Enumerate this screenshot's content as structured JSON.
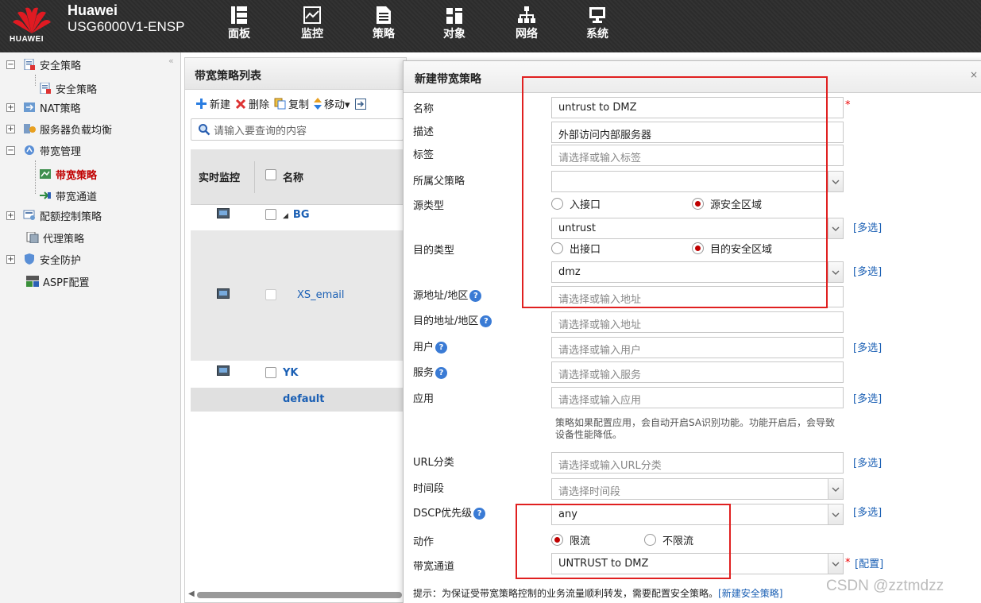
{
  "header": {
    "brand_line1": "Huawei",
    "brand_line2": "USG6000V1-ENSP",
    "logo_text": "HUAWEI",
    "nav": [
      {
        "label": "面板",
        "icon": "dashboard-icon"
      },
      {
        "label": "监控",
        "icon": "monitor-icon"
      },
      {
        "label": "策略",
        "icon": "policy-icon"
      },
      {
        "label": "对象",
        "icon": "object-icon"
      },
      {
        "label": "网络",
        "icon": "network-icon"
      },
      {
        "label": "系统",
        "icon": "system-icon"
      }
    ]
  },
  "sidebar": {
    "collapse": "«",
    "items": [
      {
        "label": "安全策略",
        "expander": "−"
      },
      {
        "label": "安全策略"
      },
      {
        "label": "NAT策略",
        "expander": "+"
      },
      {
        "label": "服务器负载均衡",
        "expander": "+"
      },
      {
        "label": "带宽管理",
        "expander": "−"
      },
      {
        "label": "带宽策略",
        "active": true
      },
      {
        "label": "带宽通道"
      },
      {
        "label": "配额控制策略",
        "expander": "+"
      },
      {
        "label": "代理策略"
      },
      {
        "label": "安全防护",
        "expander": "+"
      },
      {
        "label": "ASPF配置"
      }
    ]
  },
  "list": {
    "title": "带宽策略列表",
    "toolbar": {
      "new": "新建",
      "delete": "删除",
      "copy": "复制",
      "move": "移动▾"
    },
    "search_placeholder": "请输入要查询的内容",
    "columns": {
      "monitor": "实时监控",
      "name": "名称"
    },
    "rows": [
      {
        "name": "BG",
        "prefix": "◢"
      },
      {
        "name": "XS_email"
      },
      {
        "name": "YK"
      },
      {
        "name": "default"
      }
    ]
  },
  "dialog": {
    "title": "新建带宽策略",
    "close": "×",
    "fields": {
      "name": {
        "label": "名称",
        "value": "untrust to DMZ"
      },
      "desc": {
        "label": "描述",
        "value": "外部访问内部服务器"
      },
      "tag": {
        "label": "标签",
        "placeholder": "请选择或输入标签"
      },
      "parent": {
        "label": "所属父策略",
        "value": ""
      },
      "src_type": {
        "label": "源类型",
        "opt1": "入接口",
        "opt2": "源安全区域"
      },
      "src_zone": {
        "value": "untrust"
      },
      "dst_type": {
        "label": "目的类型",
        "opt1": "出接口",
        "opt2": "目的安全区域"
      },
      "dst_zone": {
        "value": "dmz"
      },
      "src_addr": {
        "label": "源地址/地区",
        "placeholder": "请选择或输入地址"
      },
      "dst_addr": {
        "label": "目的地址/地区",
        "placeholder": "请选择或输入地址"
      },
      "user": {
        "label": "用户",
        "placeholder": "请选择或输入用户"
      },
      "service": {
        "label": "服务",
        "placeholder": "请选择或输入服务"
      },
      "app": {
        "label": "应用",
        "placeholder": "请选择或输入应用"
      },
      "app_note": "策略如果配置应用，会自动开启SA识别功能。功能开启后，会导致设备性能降低。",
      "url": {
        "label": "URL分类",
        "placeholder": "请选择或输入URL分类"
      },
      "time": {
        "label": "时间段",
        "placeholder": "请选择时间段"
      },
      "dscp": {
        "label": "DSCP优先级",
        "value": "any"
      },
      "action": {
        "label": "动作",
        "opt1": "限流",
        "opt2": "不限流"
      },
      "channel": {
        "label": "带宽通道",
        "value": "UNTRUST to DMZ"
      }
    },
    "multi_select": "[多选]",
    "configure": "[配置]",
    "required_mark": "*",
    "help_mark": "?",
    "hint_text": "提示：为保证受带宽策略控制的业务流量顺利转发，需要配置安全策略。",
    "hint_link": "[新建安全策略]"
  },
  "watermark": "CSDN @zztmdzz"
}
